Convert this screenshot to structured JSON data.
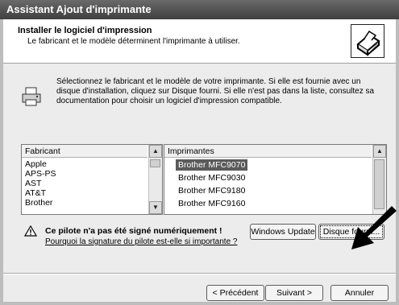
{
  "window": {
    "title": "Assistant Ajout d'imprimante"
  },
  "header": {
    "title": "Installer le logiciel d'impression",
    "subtitle": "Le fabricant et le modèle déterminent l'imprimante à utiliser."
  },
  "intro": {
    "text": "Sélectionnez le fabricant et le modèle de votre imprimante. Si elle est fournie avec un disque d'installation, cliquez sur Disque fourni. Si elle n'est pas dans la liste, consultez sa documentation pour choisir un logiciel d'impression compatible."
  },
  "manufacturers": {
    "header": "Fabricant",
    "items": [
      "Apple",
      "APS-PS",
      "AST",
      "AT&T",
      "Brother"
    ]
  },
  "printers": {
    "header": "Imprimantes",
    "items": [
      "Brother MFC9070",
      "Brother MFC9030",
      "Brother MFC9180",
      "Brother MFC9160"
    ],
    "selected_index": 0
  },
  "warning": {
    "title": "Ce pilote n'a pas été signé numériquement !",
    "link": "Pourquoi la signature du pilote est-elle si importante ?"
  },
  "buttons": {
    "windows_update": "Windows Update",
    "have_disk": "Disque fourni...",
    "back": "< Précédent",
    "next": "Suivant >",
    "cancel": "Annuler"
  }
}
